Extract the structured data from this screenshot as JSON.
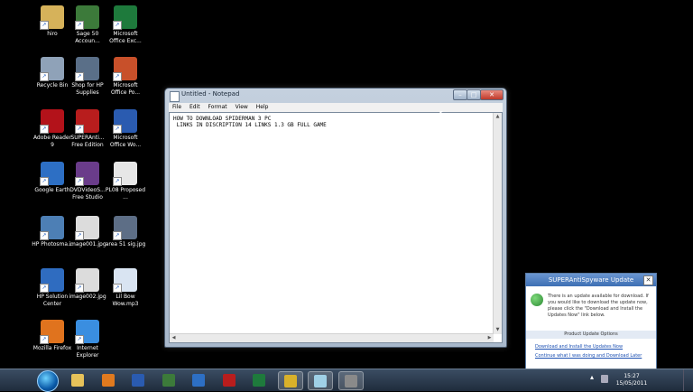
{
  "desktop_icons": [
    {
      "label": "hiro",
      "icon": "folder-icon",
      "color": "#d6b25a"
    },
    {
      "label": "Sage 50 Accoun...",
      "icon": "sage-icon",
      "color": "#3c7a3a"
    },
    {
      "label": "Microsoft Office Exc...",
      "icon": "excel-icon",
      "color": "#1e7a3c"
    },
    {
      "label": "Recycle Bin",
      "icon": "recycle-bin-icon",
      "color": "#8fa2b8"
    },
    {
      "label": "Shop for HP Supplies",
      "icon": "hp-shop-icon",
      "color": "#5a6f88"
    },
    {
      "label": "Microsoft Office Po...",
      "icon": "powerpoint-icon",
      "color": "#c8502a"
    },
    {
      "label": "Adobe Reader 9",
      "icon": "adobe-reader-icon",
      "color": "#b3121a"
    },
    {
      "label": "SUPERAnti... Free Edition",
      "icon": "superantispyware-icon",
      "color": "#b81d1d"
    },
    {
      "label": "Microsoft Office Wo...",
      "icon": "word-icon",
      "color": "#2a5bb0"
    },
    {
      "label": "Google Earth",
      "icon": "google-earth-icon",
      "color": "#2d6fc4"
    },
    {
      "label": "DVDVideoS... Free Studio",
      "icon": "dvd-studio-icon",
      "color": "#6a3c8a"
    },
    {
      "label": "PL08 Proposed ...",
      "icon": "pdf-icon",
      "color": "#e7e7e7"
    },
    {
      "label": "HP Photosma...",
      "icon": "hp-photosmart-icon",
      "color": "#4d7fb5"
    },
    {
      "label": "image001.jpg",
      "icon": "image-file-icon",
      "color": "#dcdcdc"
    },
    {
      "label": "area 51 sig.jpg",
      "icon": "image-file-icon",
      "color": "#5d6e86"
    },
    {
      "label": "HP Solution Center",
      "icon": "hp-solution-icon",
      "color": "#2f6cc0"
    },
    {
      "label": "image002.jpg",
      "icon": "image-file-icon",
      "color": "#dcdcdc"
    },
    {
      "label": "Lil Bow Wow.mp3",
      "icon": "audio-file-icon",
      "color": "#d9e4f2"
    },
    {
      "label": "Mozilla Firefox",
      "icon": "firefox-icon",
      "color": "#e0731e"
    },
    {
      "label": "Internet Explorer",
      "icon": "internet-explorer-icon",
      "color": "#3a8ee0"
    }
  ],
  "notepad": {
    "title": "Untitled - Notepad",
    "menus": [
      "File",
      "Edit",
      "Format",
      "View",
      "Help"
    ],
    "text_line1": "HOW TO DOWNLOAD SPIDERMAN 3 PC",
    "text_line2": " LINKS IN DISCRIPTION 14 LINKS 1.3 GB FULL GAME"
  },
  "popup": {
    "title": "SUPERAntiSpyware Update",
    "message": "There is an update available for download. If you would like to download the update now, please click the \"Download and Install the Updates Now\" link below.",
    "options_label": "Product Update Options",
    "link1": "Download and Install the Updates Now",
    "link2": "Continue what I was doing and Download Later"
  },
  "taskbar": {
    "buttons": [
      {
        "icon": "windows-explorer-icon",
        "color": "#e6c25a"
      },
      {
        "icon": "media-player-icon",
        "color": "#e07a1f"
      },
      {
        "icon": "word-icon",
        "color": "#2a5bb0"
      },
      {
        "icon": "sage-icon",
        "color": "#3c7a3a"
      },
      {
        "icon": "google-earth-icon",
        "color": "#2d6fc4"
      },
      {
        "icon": "superantispyware-icon",
        "color": "#b81d1d"
      },
      {
        "icon": "excel-icon",
        "color": "#1e7a3c"
      },
      {
        "icon": "chrome-icon",
        "color": "#d9b12a"
      },
      {
        "icon": "notepad-icon",
        "color": "#9fd0e6"
      },
      {
        "icon": "recording-app-icon",
        "color": "#8a8a8a"
      }
    ],
    "time": "15:27",
    "date": "15/05/2011"
  }
}
